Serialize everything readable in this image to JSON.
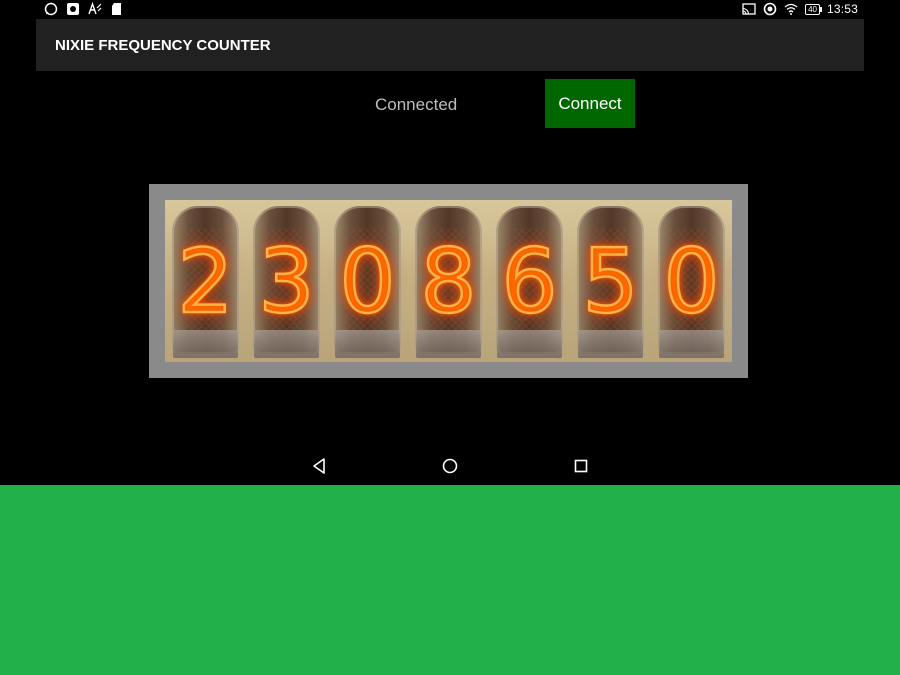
{
  "status_bar": {
    "left_icons": [
      "whatsapp-icon",
      "camera-icon",
      "text-size-icon",
      "sd-card-icon"
    ],
    "right_icons": [
      "cast-icon",
      "data-saver-icon",
      "wifi-icon"
    ],
    "battery": "40",
    "time": "13:53"
  },
  "app": {
    "title": "NIXIE FREQUENCY COUNTER"
  },
  "connection": {
    "status_text": "Connected",
    "button_label": "Connect",
    "button_color": "#006600"
  },
  "nixie": {
    "digits": [
      "2",
      "3",
      "0",
      "8",
      "6",
      "5",
      "0"
    ],
    "glow_color": "#ff6a00",
    "frame_color": "#8a8a8a"
  },
  "nav_bar": {
    "buttons": [
      "back-icon",
      "home-icon",
      "recents-icon"
    ]
  },
  "colors": {
    "screen_background": "#000000",
    "action_bar": "#212121",
    "page_background": "#22b04b"
  }
}
